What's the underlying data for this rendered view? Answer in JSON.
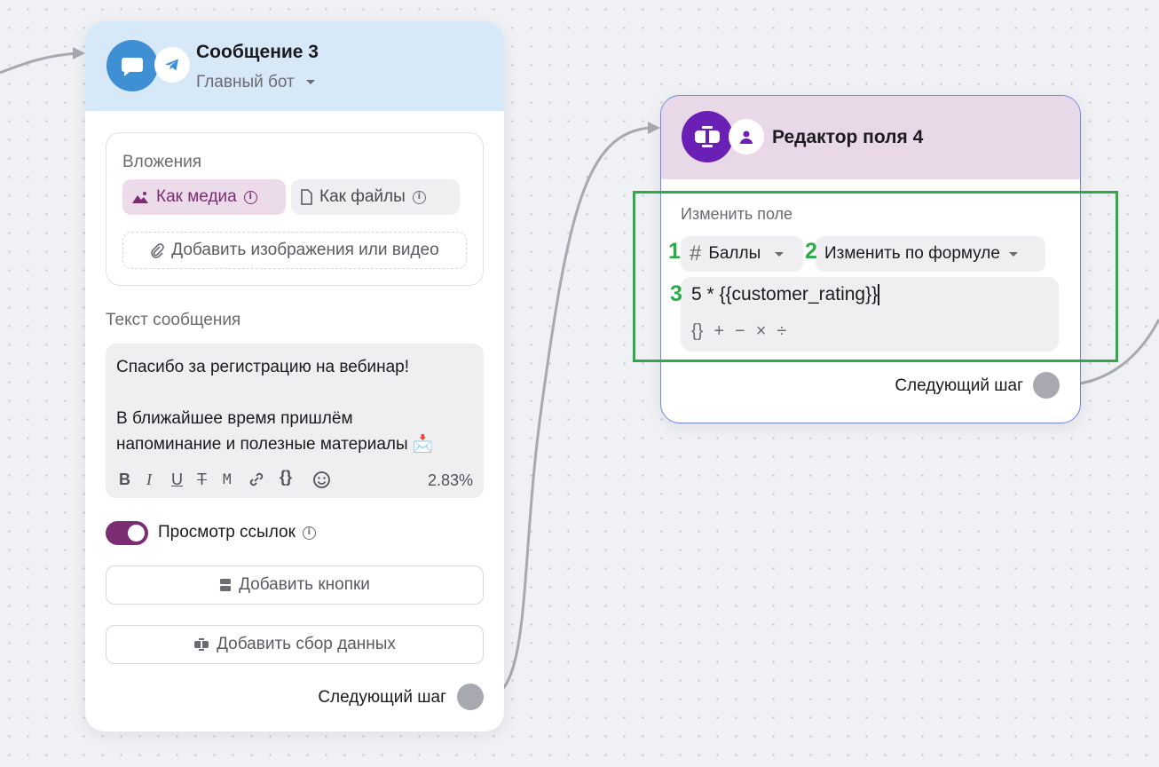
{
  "node_message": {
    "title": "Сообщение 3",
    "bot_name": "Главный бот",
    "attachments_label": "Вложения",
    "as_media_label": "Как медиа",
    "as_files_label": "Как файлы",
    "add_media_label": "Добавить изображения или видео",
    "message_text_label": "Текст сообщения",
    "message_line1": "Спасибо за регистрацию на вебинар!",
    "message_line2": "В ближайшее время пришлём",
    "message_line3": "напоминание и полезные материалы",
    "message_emoji": "📩",
    "format_bold": "B",
    "format_italic": "I",
    "format_underline": "U",
    "format_strike": "T",
    "format_mono": "M",
    "format_vars": "{}",
    "counter": "2.83%",
    "link_preview_label": "Просмотр ссылок",
    "link_preview_on": true,
    "add_buttons_label": "Добавить кнопки",
    "add_data_collection_label": "Добавить сбор данных",
    "next_step_label": "Следующий шаг"
  },
  "node_field_editor": {
    "title": "Редактор поля 4",
    "change_field_label": "Изменить поле",
    "field_name": "Баллы",
    "field_type_glyph": "#",
    "operation": "Изменить по формуле",
    "formula": "5 * {{customer_rating}}",
    "operators": [
      "{}",
      "+",
      "−",
      "×",
      "÷"
    ],
    "next_step_label": "Следующий шаг"
  },
  "annotations": {
    "n1": "1",
    "n2": "2",
    "n3": "3",
    "color": "#2eaa4a"
  },
  "colors": {
    "accent": "#7b2d74",
    "message_header": "#d7e9f8",
    "field_editor_header": "#e8d8e8",
    "messenger_blue": "#3e8fd4",
    "field_editor_purple": "#6a1fb5"
  }
}
